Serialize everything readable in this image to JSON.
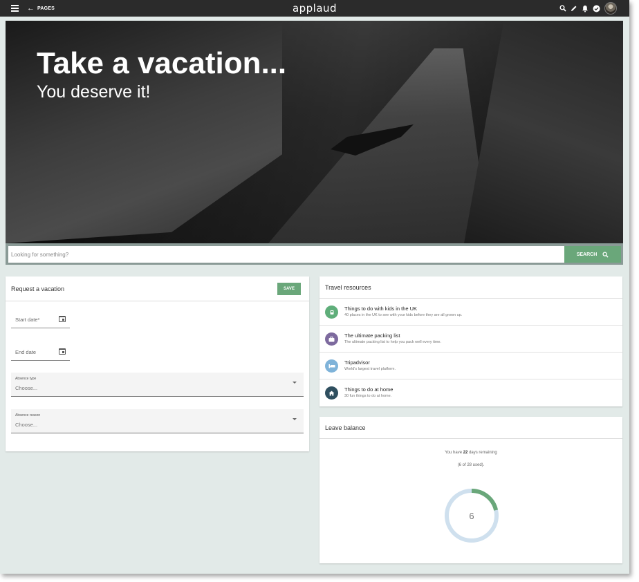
{
  "topbar": {
    "back_label": "PAGES",
    "brand": "applaud",
    "icons": [
      "menu-icon",
      "arrow-left-icon",
      "search-icon",
      "pencil-icon",
      "bell-icon",
      "check-circle-icon",
      "avatar"
    ]
  },
  "hero": {
    "title": "Take a vacation...",
    "subtitle": "You deserve it!"
  },
  "search": {
    "placeholder": "Looking for something?",
    "button_label": "SEARCH"
  },
  "request": {
    "title": "Request a vacation",
    "save_label": "SAVE",
    "start_date_label": "Start date*",
    "end_date_label": "End date",
    "absence_type_label": "Absence type",
    "absence_type_value": "Choose...",
    "absence_reason_label": "Absence reason",
    "absence_reason_value": "Choose..."
  },
  "travel": {
    "title": "Travel resources",
    "items": [
      {
        "title": "Things to do with kids in the UK",
        "desc": "40 places in the UK to see with your kids before they are all grown up.",
        "color": "#5fae7a",
        "icon": "child-icon"
      },
      {
        "title": "The ultimate packing list",
        "desc": "The ultimate packing list to help you pack well every time.",
        "color": "#7d6a9e",
        "icon": "suitcase-icon"
      },
      {
        "title": "Tripadvisor",
        "desc": "World's largest travel platform.",
        "color": "#7fb3d9",
        "icon": "bed-icon"
      },
      {
        "title": "Things to do at home",
        "desc": "30 fun things to do at home.",
        "color": "#2f4f5f",
        "icon": "home-icon"
      }
    ]
  },
  "leave": {
    "title": "Leave balance",
    "line1_prefix": "You have ",
    "remaining": "22",
    "line1_suffix": " days remaining",
    "line2": "(6 of 28 used).",
    "used": 6,
    "total": 28,
    "center_value": "6",
    "ring_color": "#cfe0ee",
    "used_color": "#6aa77a"
  },
  "colors": {
    "accent": "#6aa77a",
    "topbar": "#2b2b2b",
    "background": "#e2eae8"
  }
}
